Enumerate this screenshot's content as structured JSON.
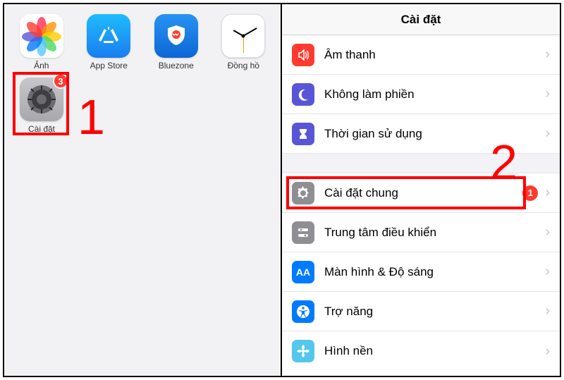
{
  "home": {
    "apps_row1": [
      {
        "label": "Ảnh",
        "icon": "photos"
      },
      {
        "label": "App Store",
        "icon": "appstore"
      },
      {
        "label": "Bluezone",
        "icon": "bluezone"
      },
      {
        "label": "Đồng hồ",
        "icon": "clock"
      }
    ],
    "apps_row2": [
      {
        "label": "Cài đặt",
        "icon": "settings",
        "badge": "3"
      }
    ],
    "annotation1": "1"
  },
  "settings": {
    "title": "Cài đặt",
    "annotation2": "2",
    "group1": [
      {
        "label": "Âm thanh",
        "icon": "sound",
        "color": "#ff3b30"
      },
      {
        "label": "Không làm phiền",
        "icon": "moon",
        "color": "#5856d6"
      },
      {
        "label": "Thời gian sử dụng",
        "icon": "hourglass",
        "color": "#5856d6"
      }
    ],
    "group2": [
      {
        "label": "Cài đặt chung",
        "icon": "gear",
        "color": "#8e8e93",
        "badge": "1",
        "highlight": true
      },
      {
        "label": "Trung tâm điều khiển",
        "icon": "switches",
        "color": "#8e8e93"
      },
      {
        "label": "Màn hình & Độ sáng",
        "icon": "AA",
        "color": "#007aff"
      },
      {
        "label": "Trợ năng",
        "icon": "person",
        "color": "#007aff"
      },
      {
        "label": "Hình nền",
        "icon": "flower",
        "color": "#54c7ec"
      }
    ]
  }
}
